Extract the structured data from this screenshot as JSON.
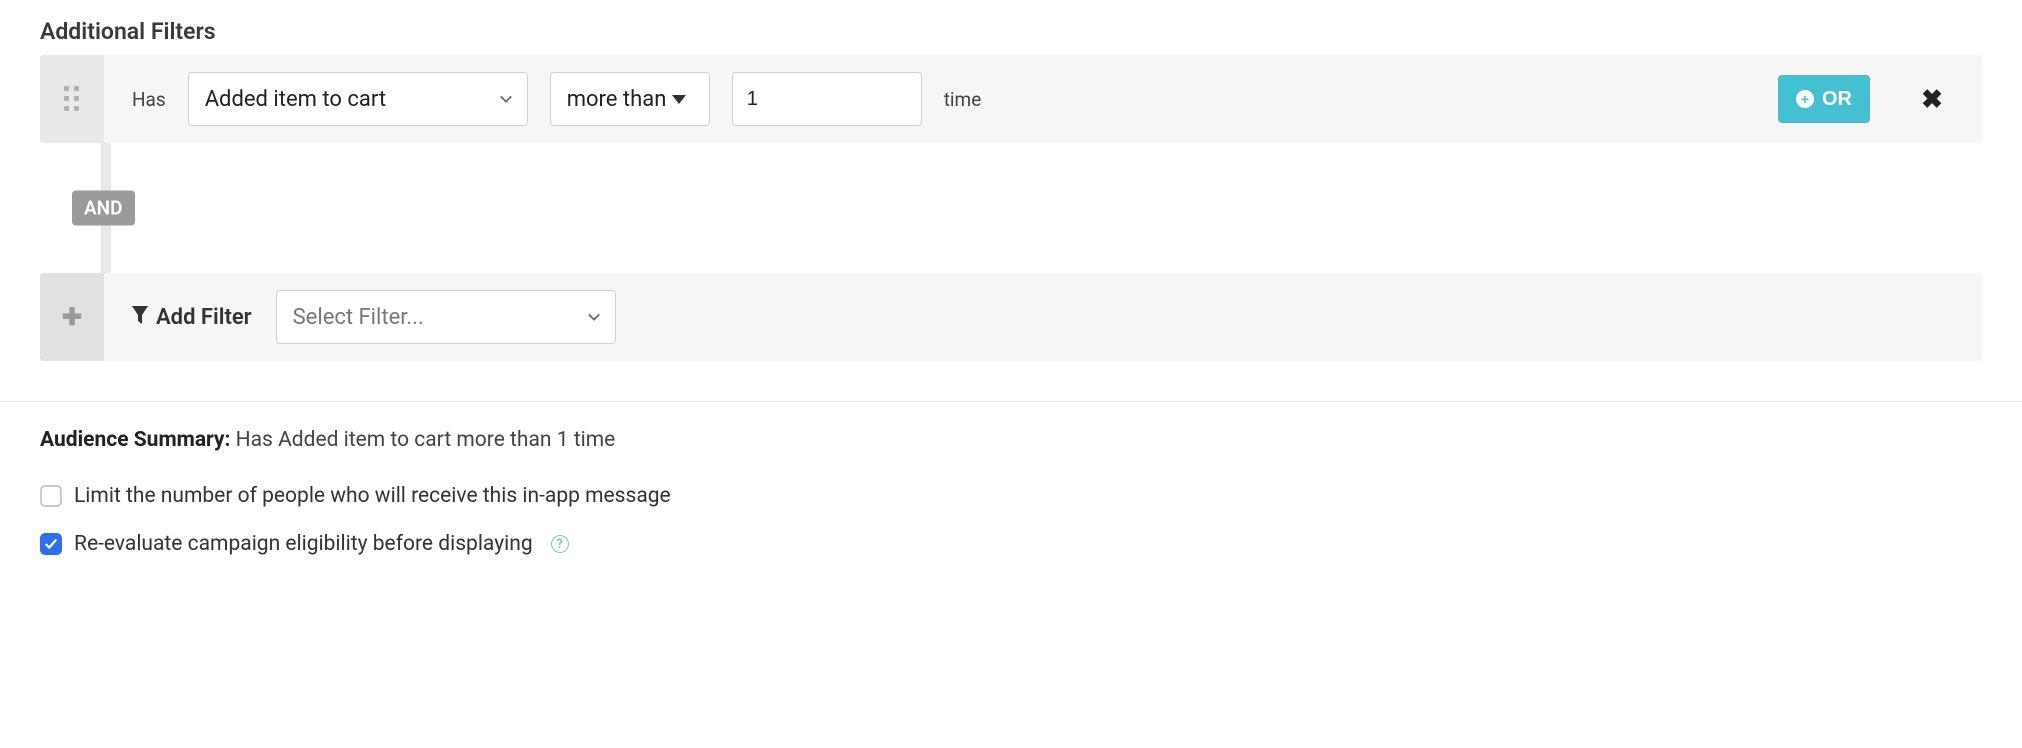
{
  "section_title": "Additional Filters",
  "filter_row": {
    "has_label": "Has",
    "event_select": "Added item to cart",
    "comparator_select": "more than",
    "count_value": "1",
    "unit_label": "time",
    "or_button_label": "OR"
  },
  "and_chip": "AND",
  "add_filter": {
    "label": "Add Filter",
    "select_placeholder": "Select Filter..."
  },
  "audience_summary": {
    "label": "Audience Summary:",
    "text": "Has Added item to cart more than 1 time"
  },
  "limit_checkbox": {
    "checked": false,
    "label": "Limit the number of people who will receive this in-app message"
  },
  "reevaluate_checkbox": {
    "checked": true,
    "label": "Re-evaluate campaign eligibility before displaying"
  }
}
